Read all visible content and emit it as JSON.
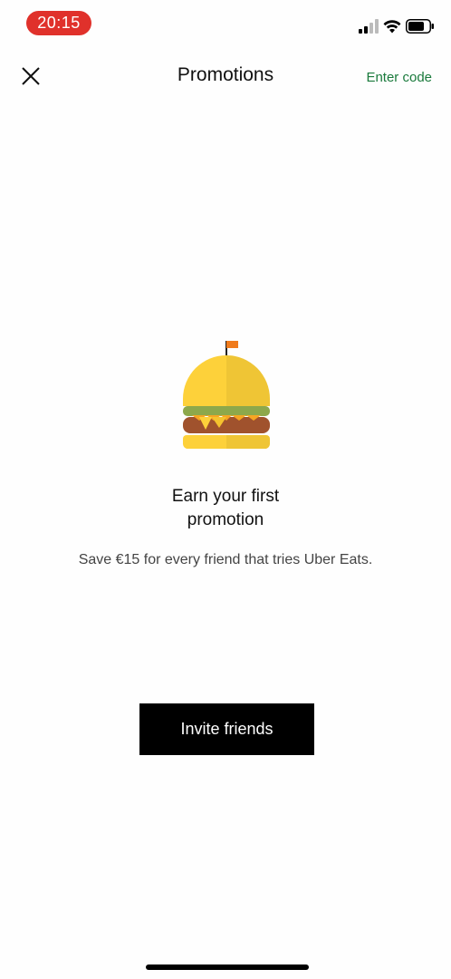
{
  "status_bar": {
    "time": "20:15",
    "signal_icon": "cellular-signal-icon",
    "wifi_icon": "wifi-icon",
    "battery_icon": "battery-icon",
    "time_pill_color": "#e0312b"
  },
  "header": {
    "close_icon": "close-icon",
    "title": "Promotions",
    "enter_code_label": "Enter code",
    "accent_color": "#1a7a3c"
  },
  "empty_state": {
    "illustration": "burger-icon",
    "headline_line1": "Earn your first",
    "headline_line2": "promotion",
    "subtext": "Save €15 for every friend that tries Uber Eats."
  },
  "actions": {
    "invite_label": "Invite friends"
  }
}
